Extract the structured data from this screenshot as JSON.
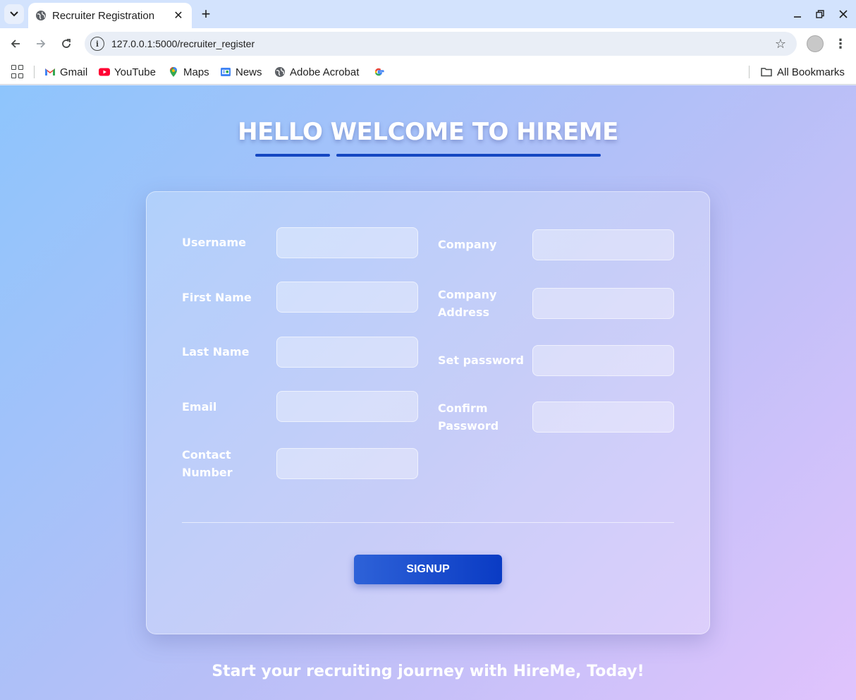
{
  "browser": {
    "tab_title": "Recruiter Registration",
    "tab_close": "✕",
    "new_tab": "+",
    "url": "127.0.0.1:5000/recruiter_register",
    "bookmarks": [
      {
        "label": "Gmail",
        "icon": "gmail-icon"
      },
      {
        "label": "YouTube",
        "icon": "youtube-icon"
      },
      {
        "label": "Maps",
        "icon": "maps-icon"
      },
      {
        "label": "News",
        "icon": "news-icon"
      },
      {
        "label": "Adobe Acrobat",
        "icon": "globe-icon"
      },
      {
        "label": "",
        "icon": "google-icon"
      }
    ],
    "all_bookmarks": "All Bookmarks"
  },
  "page": {
    "heading": "HELLO WELCOME TO HIREME",
    "tagline": "Start your recruiting journey with HireMe, Today!",
    "left_fields": [
      {
        "label": "Username",
        "value": ""
      },
      {
        "label": "First Name",
        "value": ""
      },
      {
        "label": "Last Name",
        "value": ""
      },
      {
        "label": "Email",
        "value": ""
      },
      {
        "label": "Contact Number",
        "value": ""
      }
    ],
    "right_fields": [
      {
        "label": "Company",
        "value": ""
      },
      {
        "label": "Company Address",
        "value": ""
      },
      {
        "label": "Set password",
        "value": ""
      },
      {
        "label": "Confirm Password",
        "value": ""
      }
    ],
    "signup_label": "SIGNUP"
  },
  "colors": {
    "gradient_start": "#8ec5fc",
    "gradient_end": "#e0c3fc",
    "button": "#0a3bc4",
    "underline": "#1447c2"
  }
}
